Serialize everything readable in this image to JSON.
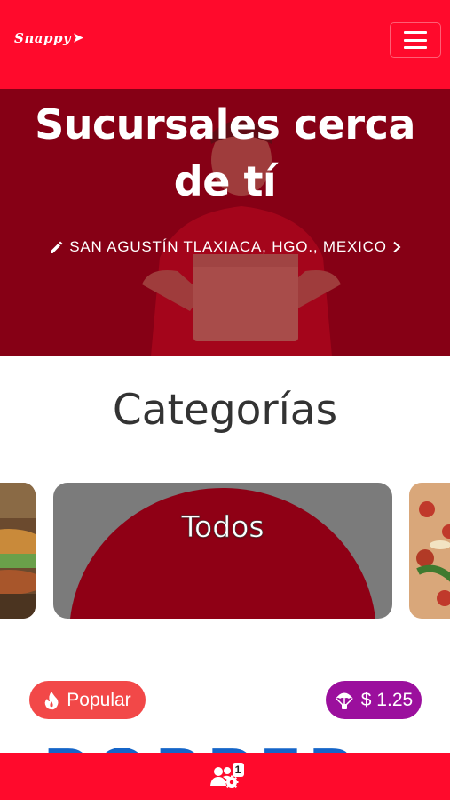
{
  "header": {
    "logo_text": "Snappy",
    "menu_icon": "hamburger-menu-icon"
  },
  "hero": {
    "title": "Sucursales cerca de tí",
    "location": "SAN AGUSTÍN TLAXIACA, HGO., MEXICO",
    "edit_icon": "pencil-icon",
    "chevron_icon": "chevron-right-icon"
  },
  "categories": {
    "title": "Categorías",
    "cards": [
      {
        "label": ""
      },
      {
        "label": "Todos"
      },
      {
        "label": ""
      }
    ]
  },
  "badges": {
    "popular_label": "Popular",
    "popular_icon": "fire-icon",
    "price_label": "$ 1.25",
    "price_icon": "parachute-icon"
  },
  "promo_peek_text": "POPPER",
  "bottom_bar": {
    "icon": "users-gear-icon",
    "notification_count": "1"
  },
  "colors": {
    "brand_red": "#ff0a2c",
    "hero_overlay": "#8a0016",
    "popular_badge": "#f24848",
    "price_badge": "#9b0f9d"
  }
}
